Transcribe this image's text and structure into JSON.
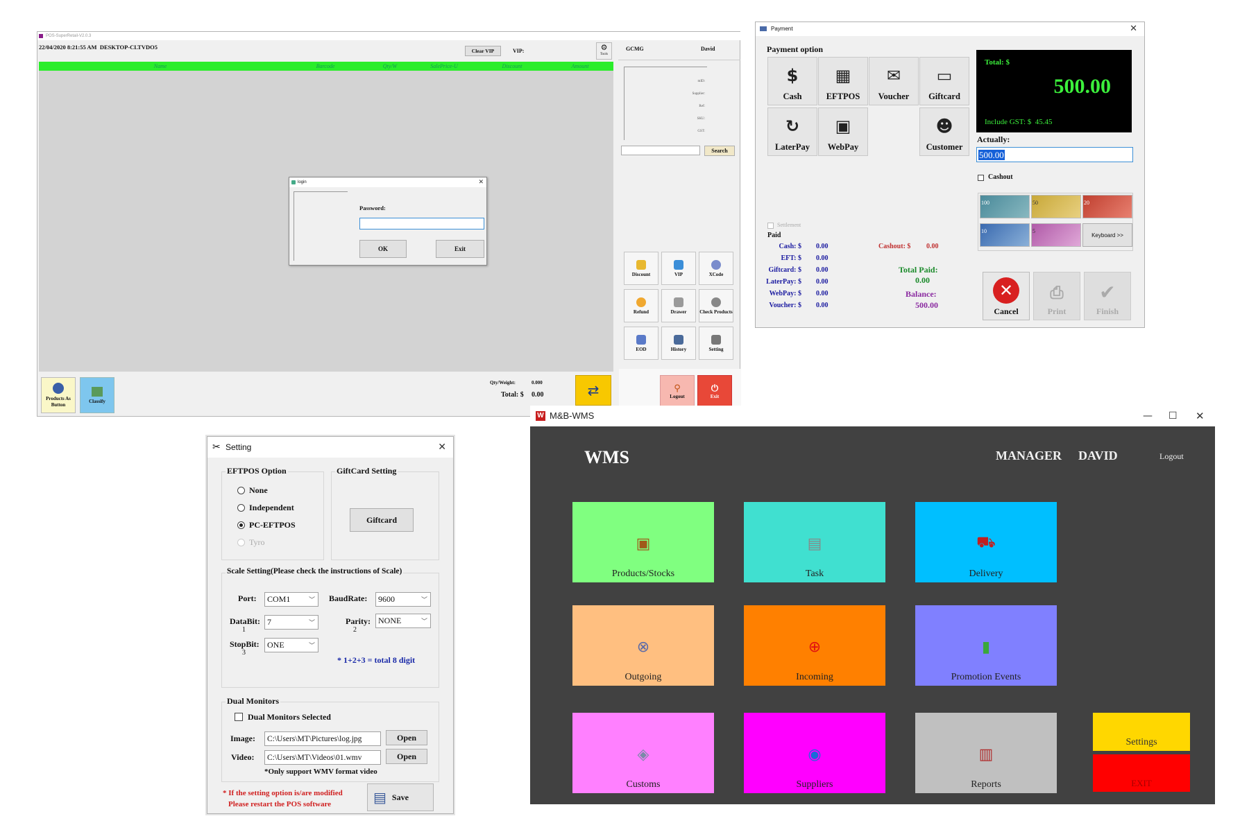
{
  "pos": {
    "title": "POS-SuperRetail-V2.0.3",
    "datetime": "22/04/2020 8:21:55 AM",
    "machine": "DESKTOP-CLTVDO5",
    "clear_vip": "Clear VIP",
    "vip_label": "VIP:",
    "tools_label": "Tools",
    "columns": [
      "Name",
      "Barcode",
      "Qty/W",
      "SalePrice-U",
      "Discount",
      "Amount"
    ],
    "store_code": "GCMG",
    "user": "David",
    "info_labels": [
      "mID:",
      "Supplier:",
      "Ref:",
      "SKU:",
      "GST:"
    ],
    "search_button": "Search",
    "login": {
      "title": "login",
      "password_label": "Password:",
      "ok": "OK",
      "exit": "Exit"
    },
    "tools": [
      {
        "label": "Discount",
        "color": "#e8b830"
      },
      {
        "label": "VIP",
        "color": "#3b8ed8"
      },
      {
        "label": "XCode",
        "color": "#7a8ccc"
      },
      {
        "label": "Refund",
        "color": "#f0a830"
      },
      {
        "label": "Drawer",
        "color": "#9a9a9a"
      },
      {
        "label": "Check Products",
        "color": "#888888"
      },
      {
        "label": "EOD",
        "color": "#5a7ac8"
      },
      {
        "label": "History",
        "color": "#4a6a9a"
      },
      {
        "label": "Setting",
        "color": "#777777"
      }
    ],
    "bottom_buttons": [
      "Products As Button",
      "Classify"
    ],
    "qty_weight_label": "Qty/Weight:",
    "qty_weight_value": "0.000",
    "total_label": "Total: $",
    "total_value": "0.00",
    "logout": "Logout",
    "exit": "Exit"
  },
  "payment": {
    "title": "Payment",
    "section": "Payment option",
    "options": [
      "Cash",
      "EFTPOS",
      "Voucher",
      "Giftcard",
      "LaterPay",
      "WebPay",
      "Customer"
    ],
    "total_label": "Total: $",
    "total_value": "500.00",
    "gst_label": "Include GST: $",
    "gst_value": "45.45",
    "actually_label": "Actually:",
    "actually_value": "500.00",
    "cashout_label": "Cashout",
    "settlement_label": "Settlement",
    "paid_title": "Paid",
    "paid_rows": [
      {
        "label": "Cash: $",
        "value": "0.00"
      },
      {
        "label": "EFT: $",
        "value": "0.00"
      },
      {
        "label": "Giftcard: $",
        "value": "0.00"
      },
      {
        "label": "LaterPay: $",
        "value": "0.00"
      },
      {
        "label": "WebPay: $",
        "value": "0.00"
      },
      {
        "label": "Voucher: $",
        "value": "0.00"
      }
    ],
    "cashout_paid_label": "Cashout: $",
    "cashout_paid_value": "0.00",
    "total_paid_label": "Total Paid:",
    "total_paid_value": "0.00",
    "balance_label": "Balance:",
    "balance_value": "500.00",
    "notes": [
      "100",
      "50",
      "20",
      "10",
      "5"
    ],
    "keyboard": "Keyboard >>",
    "cancel": "Cancel",
    "print": "Print",
    "finish": "Finish"
  },
  "setting": {
    "title": "Setting",
    "eftpos_title": "EFTPOS Option",
    "eftpos_options": [
      "None",
      "Independent",
      "PC-EFTPOS",
      "Tyro"
    ],
    "eftpos_selected": "PC-EFTPOS",
    "giftcard_title": "GiftCard Setting",
    "giftcard_button": "Giftcard",
    "scale_title": "Scale Setting(Please check the instructions of Scale)",
    "port_label": "Port:",
    "port_value": "COM1",
    "baud_label": "BaudRate:",
    "baud_value": "9600",
    "databit_label": "DataBit:",
    "databit_num": "1",
    "databit_value": "7",
    "parity_label": "Parity:",
    "parity_num": "2",
    "parity_value": "NONE",
    "stopbit_label": "StopBit:",
    "stopbit_num": "3",
    "stopbit_value": "ONE",
    "digit_note": "* 1+2+3 = total 8 digit",
    "dual_title": "Dual Monitors",
    "dual_check": "Dual Monitors Selected",
    "image_label": "Image:",
    "image_value": "C:\\Users\\MT\\Pictures\\log.jpg",
    "video_label": "Video:",
    "video_value": "C:\\Users\\MT\\Videos\\01.wmv",
    "open": "Open",
    "wmv_note": "*Only support WMV format video",
    "restart_note_1": "* If the setting option is/are modified",
    "restart_note_2": "Please restart the POS software",
    "save": "Save"
  },
  "wms": {
    "window_title": "M&B-WMS",
    "app_title": "WMS",
    "role": "MANAGER",
    "user": "DAVID",
    "logout": "Logout",
    "tiles": [
      {
        "label": "Products/Stocks",
        "color": "#80ff80",
        "icon": "box-icon"
      },
      {
        "label": "Task",
        "color": "#40e0d0",
        "icon": "task-icon"
      },
      {
        "label": "Delivery",
        "color": "#00bfff",
        "icon": "truck-icon"
      },
      {
        "label": "Outgoing",
        "color": "#ffbf80",
        "icon": "outgoing-icon"
      },
      {
        "label": "Incoming",
        "color": "#ff8000",
        "icon": "incoming-icon"
      },
      {
        "label": "Promotion Events",
        "color": "#8080ff",
        "icon": "promotion-icon"
      },
      {
        "label": "Customs",
        "color": "#ff80ff",
        "icon": "customs-icon"
      },
      {
        "label": "Suppliers",
        "color": "#ff00ff",
        "icon": "globe-icon"
      },
      {
        "label": "Reports",
        "color": "#c0c0c0",
        "icon": "reports-icon"
      }
    ],
    "settings": "Settings",
    "exit": "EXIT"
  }
}
